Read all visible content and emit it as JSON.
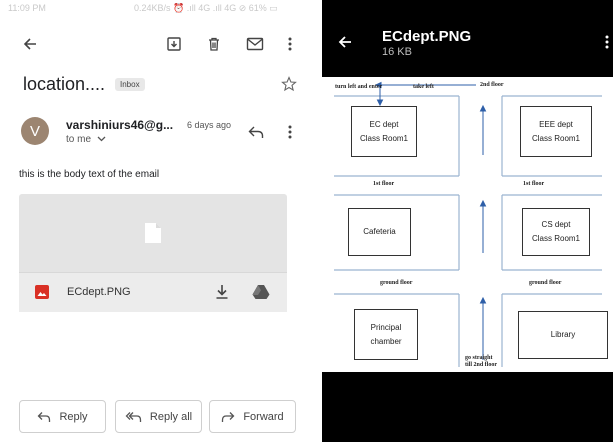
{
  "gmail": {
    "statusbar": {
      "time": "11:09 PM",
      "info": "0.24KB/s ⏰ .ıll 4G .ıll 4G ⊘ 61% ▭"
    },
    "toolbar": {
      "back": "back-arrow-icon",
      "archive": "archive-icon",
      "delete": "trash-icon",
      "mark_unread": "mail-icon",
      "more": "more-vert-icon"
    },
    "subject": "location....",
    "label": "Inbox",
    "sender": {
      "initial": "V",
      "name": "varshiniurs46@g...",
      "date": "6 days ago",
      "to": "to me"
    },
    "body": "this is the body text of the email",
    "attachment": {
      "filename": "ECdept.PNG"
    },
    "actions": {
      "reply": "Reply",
      "reply_all": "Reply all",
      "forward": "Forward"
    }
  },
  "viewer": {
    "title": "ECdept.PNG",
    "size": "16 KB",
    "floorplan": {
      "rooms": {
        "ec": [
          "EC dept",
          "Class Room1"
        ],
        "eee": [
          "EEE dept",
          "Class Room1"
        ],
        "cafeteria": [
          "Cafeteria"
        ],
        "cs": [
          "CS dept",
          "Class Room1"
        ],
        "principal": [
          "Principal",
          "chamber"
        ],
        "library": [
          "Library"
        ]
      },
      "labels": {
        "turn_left": "turn left and enter",
        "take_left": "take left",
        "second_floor": "2nd floor",
        "first_floor_left": "1st floor",
        "first_floor_right": "1st floor",
        "ground_floor_left": "ground floor",
        "ground_floor_right": "ground floor",
        "go_straight_1": "go straight",
        "go_straight_2": "till 2nd floor"
      }
    }
  },
  "colors": {
    "accent_red": "#d93025",
    "avatar": "#9c8571",
    "arrow": "#2e5fa8",
    "viewer_bg": "#000000"
  }
}
